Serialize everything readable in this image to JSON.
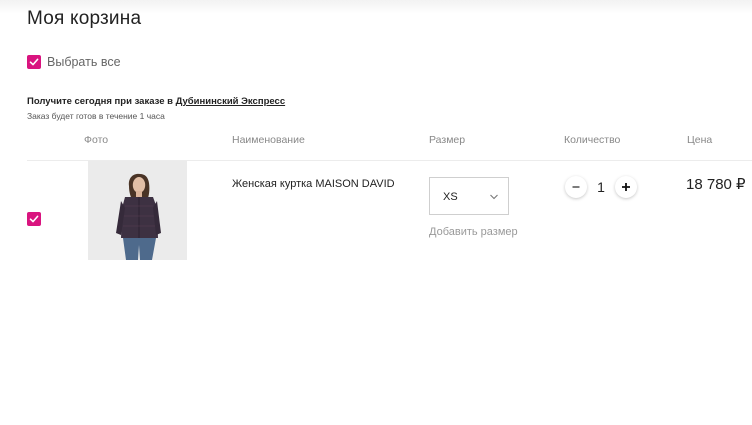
{
  "cart": {
    "title": "Моя корзина",
    "select_all_label": "Выбрать все",
    "pickup": {
      "prefix": "Получите сегодня при заказе в ",
      "store": "Дубининский Экспресс",
      "ready_note": "Заказ будет готов в течение 1 часа"
    },
    "columns": {
      "photo": "Фото",
      "name": "Наименование",
      "size": "Размер",
      "quantity": "Количество",
      "price": "Цена"
    },
    "items": [
      {
        "checked": true,
        "name": "Женская куртка MAISON DAVID",
        "size": "XS",
        "add_size_label": "Добавить размер",
        "quantity": "1",
        "price": "18 780 ₽"
      }
    ]
  },
  "colors": {
    "accent": "#d9147f",
    "jacket": "#3d3142",
    "jeans": "#4e6a8c"
  }
}
